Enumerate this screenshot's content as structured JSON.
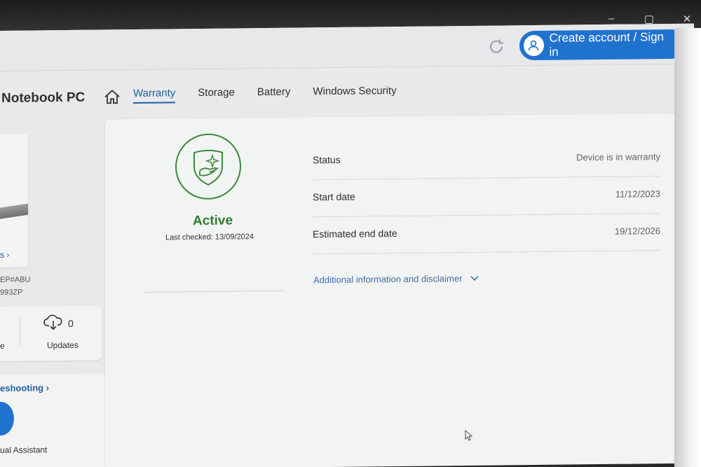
{
  "window_controls": {
    "minimize": "–",
    "maximize": "▢",
    "close": "✕"
  },
  "header": {
    "signin_label": "Create account / Sign in"
  },
  "device": {
    "title": "Notebook PC",
    "link_fragment": "s ›",
    "sku_fragment_1": "EP#ABU",
    "sku_fragment_2": "993ZP"
  },
  "tabs": [
    {
      "label": "Warranty"
    },
    {
      "label": "Storage"
    },
    {
      "label": "Battery"
    },
    {
      "label": "Windows Security"
    }
  ],
  "updates": {
    "count": "0",
    "label": "Updates",
    "left_fragment": "e"
  },
  "troubleshooting": {
    "link_fragment": "eshooting ›",
    "assistant_fragment": "ual Assistant"
  },
  "warranty": {
    "status_word": "Active",
    "last_checked": "Last checked: 13/09/2024",
    "rows": [
      {
        "label": "Status",
        "value": "Device is in warranty"
      },
      {
        "label": "Start date",
        "value": "11/12/2023"
      },
      {
        "label": "Estimated end date",
        "value": "19/12/2026"
      }
    ],
    "disclaimer": "Additional information and disclaimer"
  },
  "colors": {
    "accent": "#1f73cf",
    "active_green": "#2f7d2e",
    "link": "#3f6fa6"
  }
}
